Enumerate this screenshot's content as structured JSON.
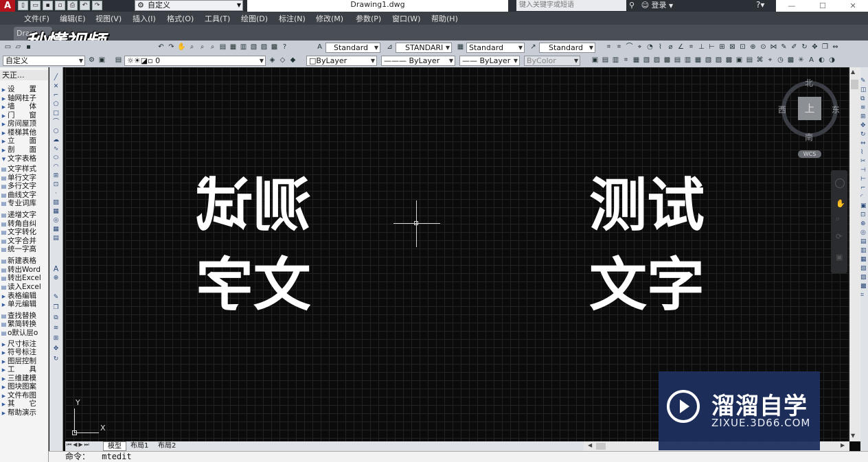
{
  "app": {
    "logo": "A",
    "workspace": "自定义",
    "doc_title": "Drawing1.dwg",
    "search_placeholder": "键入关键字或短语",
    "login": "登录",
    "window_controls": [
      "—",
      "☐",
      "✕"
    ]
  },
  "menu": [
    "文件(F)",
    "编辑(E)",
    "视图(V)",
    "插入(I)",
    "格式(O)",
    "工具(T)",
    "绘图(D)",
    "标注(N)",
    "修改(M)",
    "参数(P)",
    "窗口(W)",
    "帮助(H)"
  ],
  "doc_tab": "Drav",
  "watermark_top": "秒懂视频",
  "styles_toolbar": {
    "text_style": "Standard",
    "dim_style": "STANDARI",
    "table_style": "Standard",
    "mleader_style": "Standard"
  },
  "props_toolbar": {
    "workspace2": "自定义",
    "layer": "0",
    "color": "ByLayer",
    "linetype": "ByLayer",
    "lineweight": "ByLayer",
    "plotstyle": "ByColor"
  },
  "left_panel": {
    "title": "天正...",
    "items": [
      {
        "label": "设　　置",
        "type": "arrow"
      },
      {
        "label": "轴网柱子",
        "type": "arrow"
      },
      {
        "label": "墙　　体",
        "type": "arrow"
      },
      {
        "label": "门　　窗",
        "type": "arrow"
      },
      {
        "label": "房间屋顶",
        "type": "arrow"
      },
      {
        "label": "楼梯其他",
        "type": "arrow"
      },
      {
        "label": "立　　面",
        "type": "arrow"
      },
      {
        "label": "剖　　面",
        "type": "arrow"
      },
      {
        "label": "文字表格",
        "type": "open"
      },
      {
        "label": "文字样式",
        "type": "icon"
      },
      {
        "label": "单行文字",
        "type": "icon"
      },
      {
        "label": "多行文字",
        "type": "icon"
      },
      {
        "label": "曲线文字",
        "type": "icon"
      },
      {
        "label": "专业词库",
        "type": "icon"
      },
      {
        "label": "递增文字",
        "type": "icon"
      },
      {
        "label": "转角自纠",
        "type": "icon"
      },
      {
        "label": "文字转化",
        "type": "icon"
      },
      {
        "label": "文字合并",
        "type": "icon"
      },
      {
        "label": "统一字高",
        "type": "icon"
      },
      {
        "label": "新建表格",
        "type": "icon"
      },
      {
        "label": "转出Word",
        "type": "icon"
      },
      {
        "label": "转出Excel",
        "type": "icon"
      },
      {
        "label": "读入Excel",
        "type": "icon"
      },
      {
        "label": "表格编辑",
        "type": "arrow"
      },
      {
        "label": "单元编辑",
        "type": "arrow"
      },
      {
        "label": "查找替换",
        "type": "icon"
      },
      {
        "label": "繁简转换",
        "type": "icon"
      },
      {
        "label": "o默认层o",
        "type": "icon"
      },
      {
        "label": "尺寸标注",
        "type": "arrow"
      },
      {
        "label": "符号标注",
        "type": "arrow"
      },
      {
        "label": "图层控制",
        "type": "arrow"
      },
      {
        "label": "工　　具",
        "type": "arrow"
      },
      {
        "label": "三维建模",
        "type": "arrow"
      },
      {
        "label": "图块图案",
        "type": "arrow"
      },
      {
        "label": "文件布图",
        "type": "arrow"
      },
      {
        "label": "其　　它",
        "type": "arrow"
      },
      {
        "label": "帮助演示",
        "type": "arrow"
      }
    ]
  },
  "drawing": {
    "mirrored_line1": "测试",
    "mirrored_line2": "文字",
    "normal_line1": "测试",
    "normal_line2": "文字"
  },
  "viewcube": {
    "north": "北",
    "south": "南",
    "east": "东",
    "west": "西",
    "face": "上",
    "wcs": "WCS"
  },
  "ucs": {
    "x": "X",
    "y": "Y"
  },
  "layout_tabs": [
    "模型",
    "布局1",
    "布局2"
  ],
  "command": {
    "prompt": "命令：",
    "text": "mtedit"
  },
  "watermark_bottom": {
    "title": "溜溜自学",
    "url": "ZIXUE.3D66.COM"
  }
}
